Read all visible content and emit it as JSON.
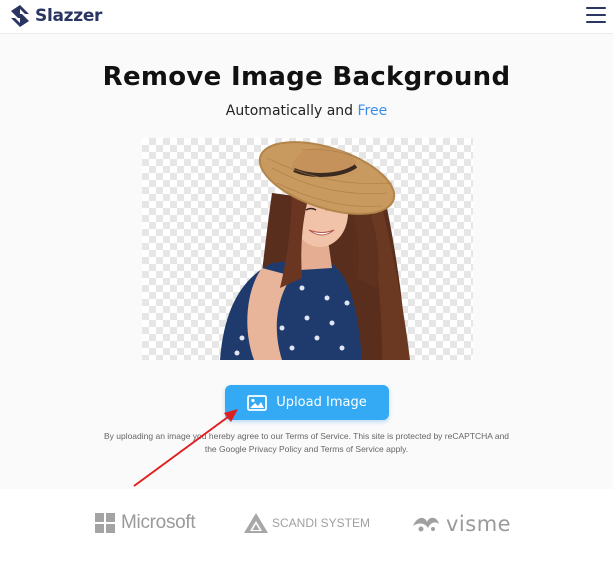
{
  "header": {
    "brand_name": "Slazzer",
    "logo_icon": "slazzer-logo-icon",
    "menu_icon": "hamburger-menu-icon"
  },
  "hero": {
    "title": "Remove Image Background",
    "subtitle_prefix": "Automatically and ",
    "subtitle_highlight": "Free",
    "highlight_color": "#3b8ee8"
  },
  "preview": {
    "description_icon": "transparent-background-photo"
  },
  "upload": {
    "button_label": "Upload Image",
    "button_icon": "image-icon",
    "button_color": "#33aaf3"
  },
  "disclaimer": {
    "part1": "By uploading an image you hereby agree to our ",
    "terms_link": "Terms of Service",
    "part2": ". This site is protected by reCAPTCHA and the ",
    "privacy_link": "Google Privacy Policy",
    "part3": " and ",
    "terms_link_2": "Terms of Service",
    "part4": " apply."
  },
  "partners": {
    "items": [
      {
        "name": "Microsoft",
        "icon": "microsoft-logo-icon"
      },
      {
        "name": "SCANDI SYSTEM",
        "icon": "scandi-system-logo-icon"
      },
      {
        "name": "visme",
        "icon": "visme-logo-icon"
      }
    ]
  },
  "annotation": {
    "arrow_color": "#e02020",
    "arrow_icon": "red-arrow-annotation"
  }
}
